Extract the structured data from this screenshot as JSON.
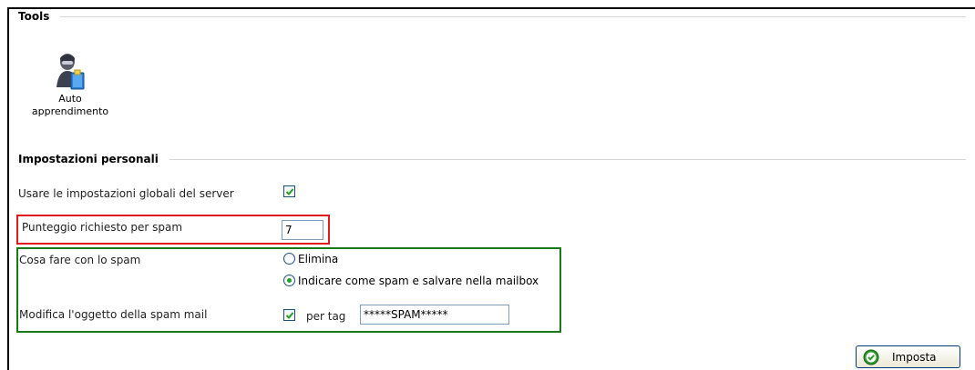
{
  "tools": {
    "header": "Tools",
    "auto_learn": {
      "line1": "Auto",
      "line2": "apprendimento",
      "icon": "user-book-icon"
    }
  },
  "personal": {
    "header": "Impostazioni personali",
    "use_global_label": "Usare le impostazioni globali del server",
    "use_global_checked": true,
    "score_label": "Punteggio richiesto per spam",
    "score_value": "7",
    "action_label": "Cosa fare con lo spam",
    "options": [
      {
        "label": "Elimina",
        "checked": false
      },
      {
        "label": "Indicare come spam e salvare nella mailbox",
        "checked": true
      }
    ],
    "subject_label": "Modifica l'oggetto della spam mail",
    "subject_checked": true,
    "per_tag_label": "per tag",
    "tag_value": "*****SPAM*****"
  },
  "buttons": {
    "submit_label": "Imposta",
    "submit_icon": "check-circle-icon"
  },
  "colors": {
    "highlight_red": "#e01b1b",
    "highlight_green": "#1a7a1a",
    "check_green": "#21a121",
    "control_border": "#1c5180"
  }
}
